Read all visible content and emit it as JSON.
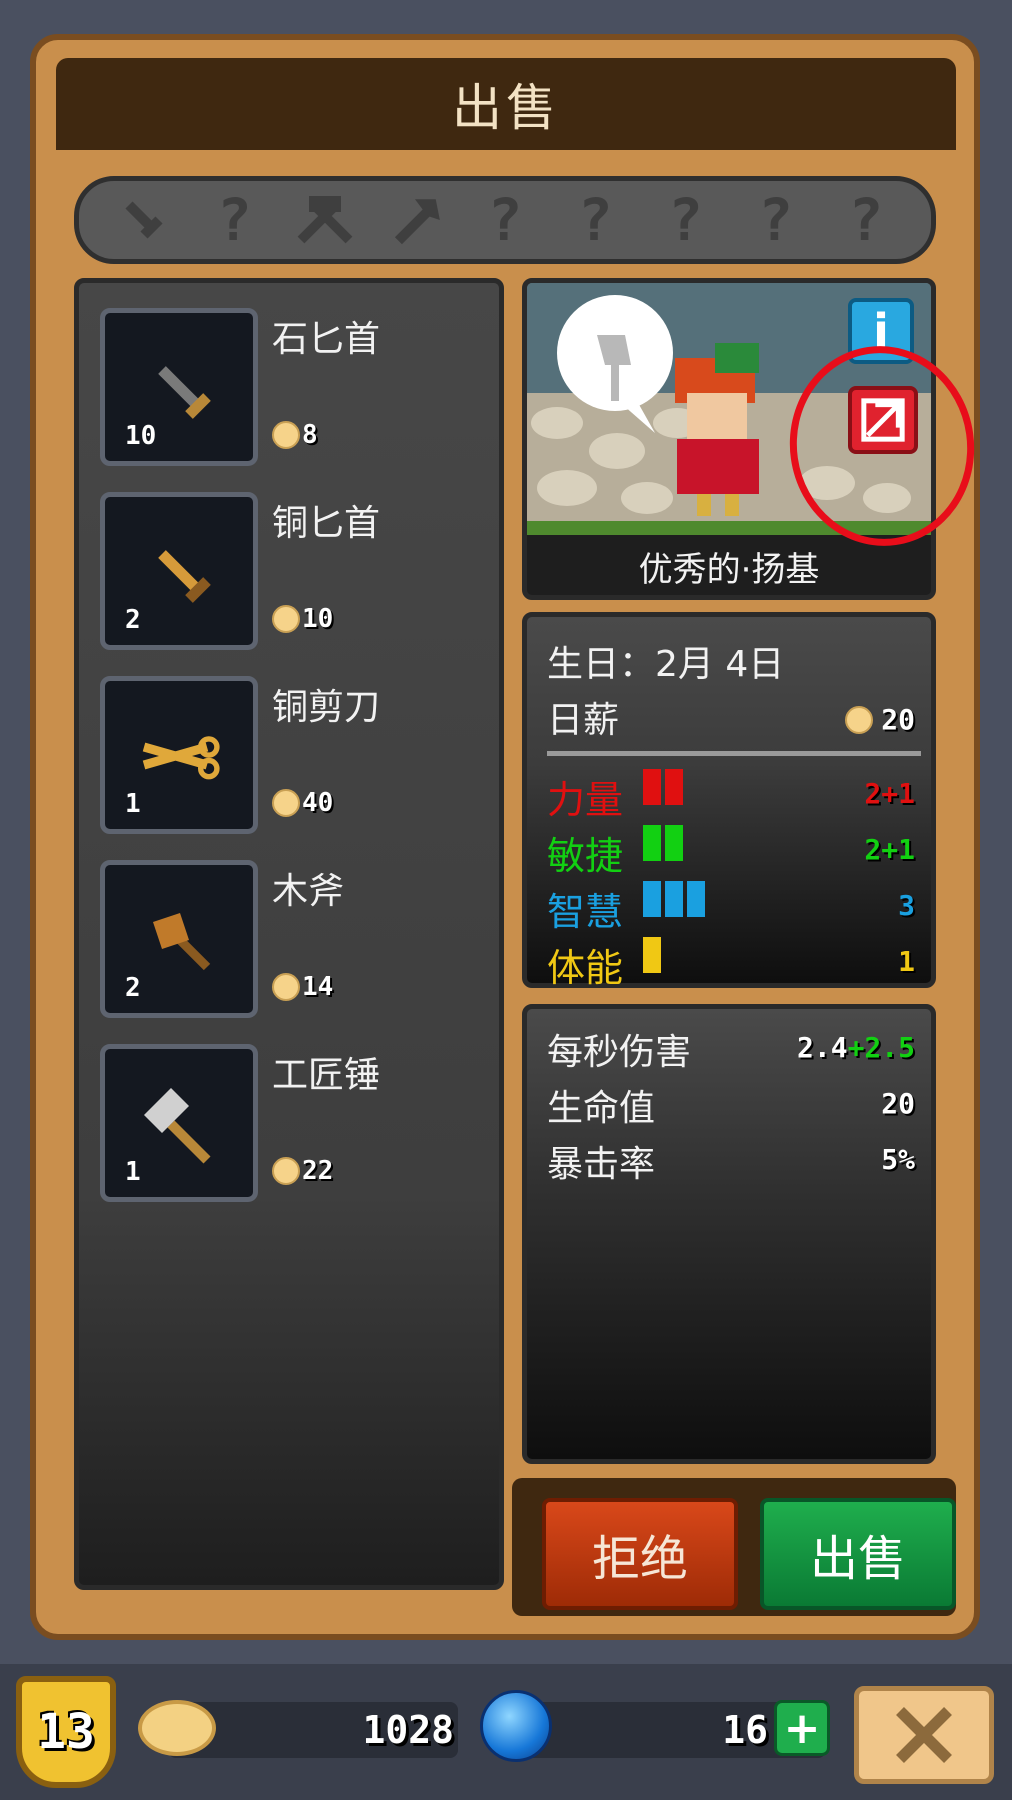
{
  "dialog": {
    "title": "出售"
  },
  "collection": {
    "slots": [
      {
        "icon": "dagger-icon",
        "known": true
      },
      {
        "icon": "unknown-icon",
        "label": "?"
      },
      {
        "icon": "crossed-axes-icon",
        "known": true
      },
      {
        "icon": "axe-icon",
        "known": true
      },
      {
        "icon": "unknown-icon",
        "label": "?"
      },
      {
        "icon": "unknown-icon",
        "label": "?"
      },
      {
        "icon": "unknown-icon",
        "label": "?"
      },
      {
        "icon": "unknown-icon",
        "label": "?"
      },
      {
        "icon": "unknown-icon",
        "label": "?"
      }
    ]
  },
  "items": [
    {
      "name": "石匕首",
      "qty": "10",
      "price": "8",
      "icon": "stone-dagger-icon"
    },
    {
      "name": "铜匕首",
      "qty": "2",
      "price": "10",
      "icon": "copper-dagger-icon"
    },
    {
      "name": "铜剪刀",
      "qty": "1",
      "price": "40",
      "icon": "copper-scissors-icon"
    },
    {
      "name": "木斧",
      "qty": "2",
      "price": "14",
      "icon": "wooden-axe-icon"
    },
    {
      "name": "工匠锤",
      "qty": "1",
      "price": "22",
      "icon": "craftsman-hammer-icon"
    }
  ],
  "character": {
    "name": "优秀的·扬基",
    "birthday_label": "生日：",
    "birthday": "2月 4日",
    "salary_label": "日薪",
    "salary": "20",
    "stats": [
      {
        "label": "力量",
        "color": "#e01010",
        "bars": 2,
        "value": "2+1"
      },
      {
        "label": "敏捷",
        "color": "#12d012",
        "bars": 2,
        "value": "2+1"
      },
      {
        "label": "智慧",
        "color": "#1aa0e0",
        "bars": 3,
        "value": "3"
      },
      {
        "label": "体能",
        "color": "#f0c814",
        "bars": 1,
        "value": "1"
      }
    ],
    "combat": {
      "dps_label": "每秒伤害",
      "dps_base": "2.4",
      "dps_bonus": "+2.5",
      "hp_label": "生命值",
      "hp": "20",
      "crit_label": "暴击率",
      "crit": "5%"
    }
  },
  "actions": {
    "reject": "拒绝",
    "sell": "出售"
  },
  "footer": {
    "level": "13",
    "gold": "1028",
    "gems": "16",
    "add_label": "+"
  },
  "colors": {
    "frame": "#c98f4c",
    "reject": "#c93c12",
    "sell": "#13944a",
    "annotation": "#e80d1a"
  }
}
